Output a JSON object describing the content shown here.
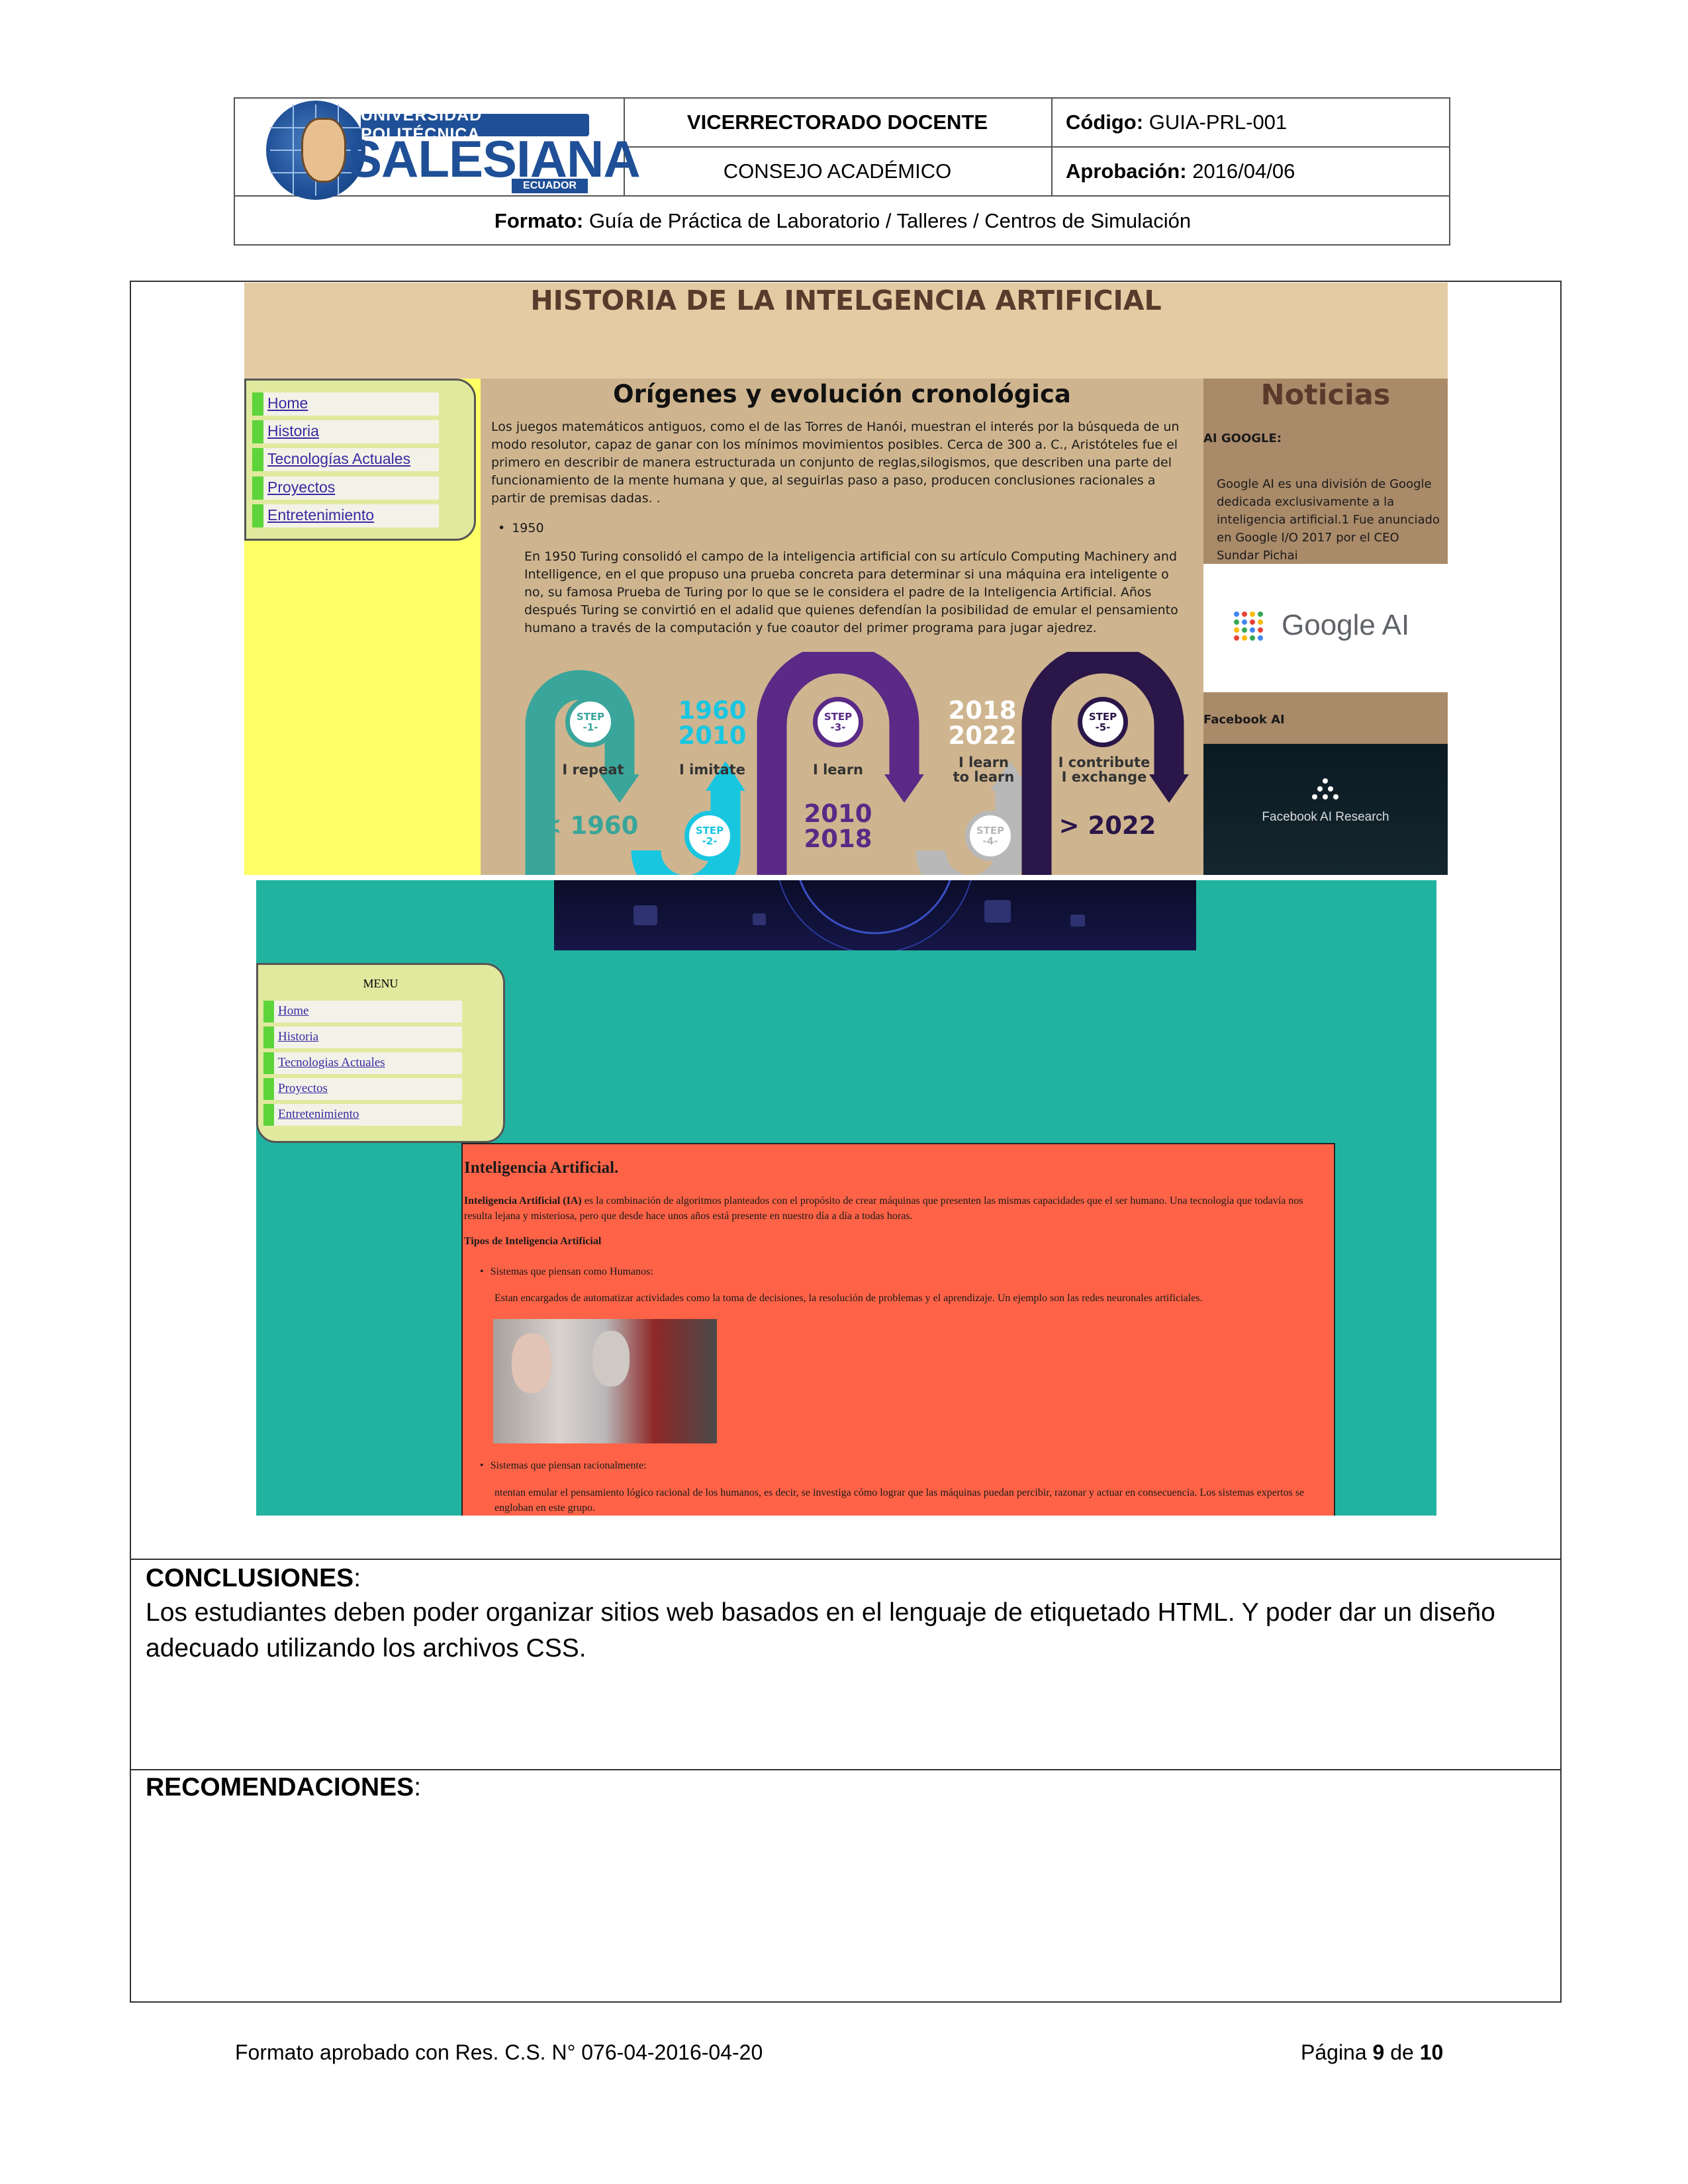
{
  "header": {
    "logo": {
      "upper": "UNIVERSIDAD POLITÉCNICA",
      "main": "SALESIANA",
      "country": "ECUADOR"
    },
    "vicerrectorado": "VICERRECTORADO DOCENTE",
    "codigo_label": "Código:",
    "codigo_value": "GUIA-PRL-001",
    "consejo": "CONSEJO ACADÉMICO",
    "aprobacion_label": "Aprobación:",
    "aprobacion_value": "2016/04/06",
    "formato_label": "Formato:",
    "formato_value": "Guía de Práctica de Laboratorio / Talleres / Centros de Simulación"
  },
  "screenshot1": {
    "banner_title": "HISTORIA DE LA INTELGENCIA ARTIFICIAL",
    "nav": [
      "Home",
      "Historia",
      "Tecnologías Actuales",
      "Proyectos",
      "Entretenimiento"
    ],
    "center_title": "Orígenes y evolución cronológica",
    "paragraph1": "Los juegos matemáticos antiguos, como el de las Torres de Hanói, muestran el interés por la búsqueda de un modo resolutor, capaz de ganar con los mínimos movimientos posibles. Cerca de 300 a. C., Aristóteles fue el primero en describir de manera estructurada un conjunto de reglas,silogismos, que describen una parte del funcionamiento de la mente humana y que, al seguirlas paso a paso, producen conclusiones racionales a partir de premisas dadas. .",
    "bullet_year": "1950",
    "paragraph2": "En 1950 Turing consolidó el campo de la inteligencia artificial con su artículo Computing Machinery and Intelligence, en el que propuso una prueba concreta para determinar si una máquina era inteligente o no, su famosa Prueba de Turing por lo que se le considera el padre de la Inteligencia Artificial. Años después Turing se convirtió en el adalid que quienes defendían la posibilidad de emular el pensamiento humano a través de la computación y fue coautor del primer programa para jugar ajedrez.",
    "timeline": {
      "steps": [
        {
          "label": "STEP",
          "num": "-1-",
          "color": "#3aa59a"
        },
        {
          "label": "STEP",
          "num": "-2-",
          "color": "#19c6e0"
        },
        {
          "label": "STEP",
          "num": "-3-",
          "color": "#5a2a86"
        },
        {
          "label": "STEP",
          "num": "-4-",
          "color": "#b8b8b8"
        },
        {
          "label": "STEP",
          "num": "-5-",
          "color": "#2a1648"
        }
      ],
      "captions": [
        "I repeat",
        "I imitate",
        "I learn",
        "I learn\nto learn",
        "I contribute\nI exchange"
      ],
      "years": [
        "< 1960",
        "1960\n2010",
        "2010\n2018",
        "2018\n2022",
        "> 2022"
      ],
      "year_colors": [
        "#3aa59a",
        "#19c6e0",
        "#5a2a86",
        "#ffffff",
        "#2a1648"
      ]
    },
    "noticias_title": "Noticias",
    "google_heading": "AI GOOGLE:",
    "google_text": "Google AI es una división de Google dedicada exclusivamente a la inteligencia artificial.1 Fue anunciado en Google I/O 2017 por el CEO Sundar Pichai",
    "google_logo_text": "Google AI",
    "facebook_heading": "Facebook AI",
    "facebook_logo_text": "Facebook AI Research"
  },
  "screenshot2": {
    "menu_title": "MENU",
    "nav": [
      "Home",
      "Historia",
      "Tecnologias Actuales",
      "Proyectos",
      "Entretenimiento"
    ],
    "article_title": "Inteligencia Artificial.",
    "intro_bold": "Inteligencia Artificial (IA)",
    "intro_rest": " es la combinación de algoritmos planteados con el propósito de crear máquinas que presenten las mismas capacidades que el ser humano. Una tecnología que todavía nos resulta lejana y misteriosa, pero que desde hace unos años está presente en nuestro día a día a todas horas.",
    "types_title": "Tipos de Inteligencia Artificial",
    "type1": "Sistemas que piensan como Humanos:",
    "type1_text": "Estan encargados de automatizar actividades como la toma de decisiones, la resolución de problemas y el aprendizaje. Un ejemplo son las redes neuronales artificiales.",
    "type2": "Sistemas que piensan racionalmente:",
    "type2_text": "ntentan emular el pensamiento lógico racional de los humanos, es decir, se investiga cómo lograr que las máquinas puedan percibir, razonar y actuar en consecuencia. Los sistemas expertos se engloban en este grupo."
  },
  "conclusiones": {
    "title": "CONCLUSIONES",
    "text": "Los estudiantes deben poder organizar sitios web basados en el lenguaje de etiquetado HTML. Y poder dar un diseño adecuado utilizando los archivos CSS."
  },
  "recomendaciones": {
    "title": "RECOMENDACIONES"
  },
  "footer": {
    "left": "Formato aprobado con Res. C.S. N° 076-04-2016-04-20",
    "page_label": "Página",
    "page_current": "9",
    "page_of": "de",
    "page_total": "10"
  }
}
